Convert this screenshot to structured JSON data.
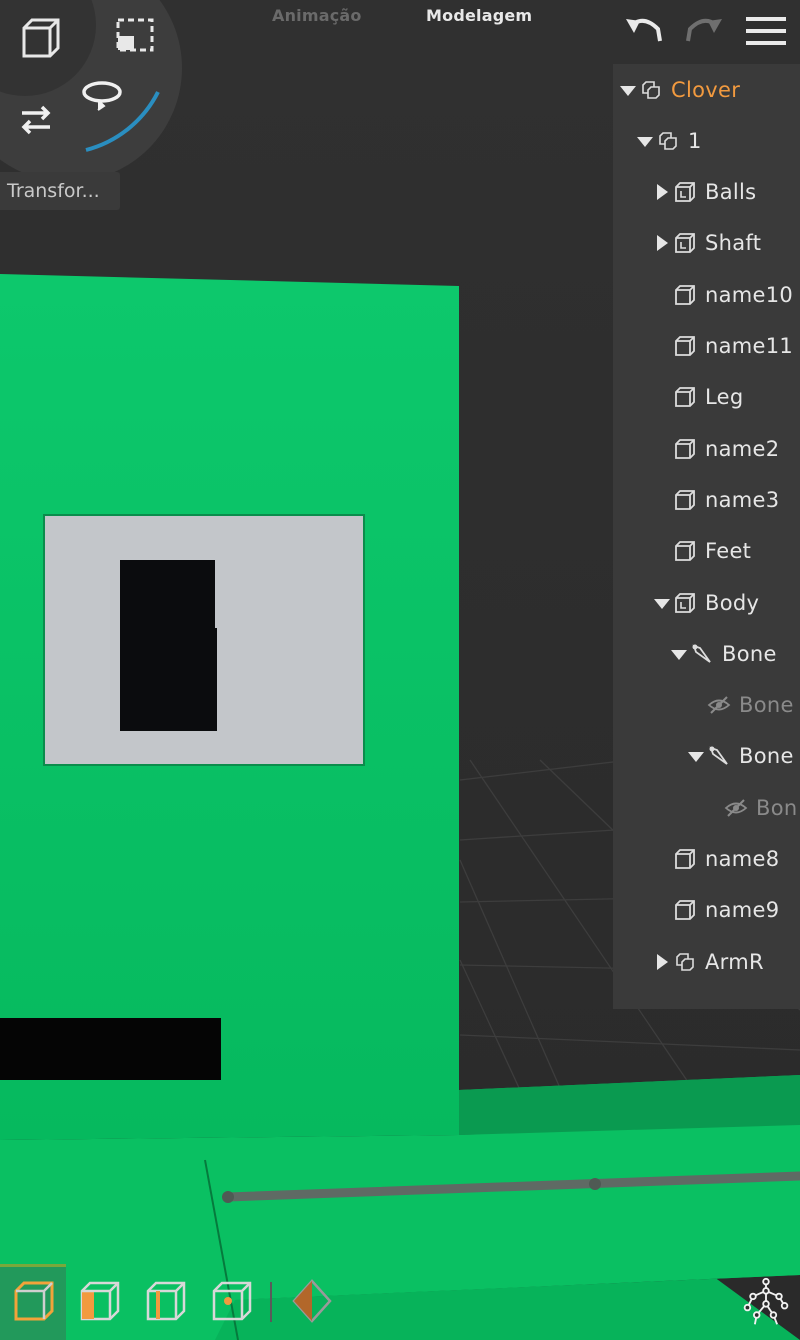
{
  "modes": {
    "animation_label": "Animação",
    "modeling_label": "Modelagem",
    "active": "Modelagem"
  },
  "gizmo": {
    "cube_icon": "cube-view-icon",
    "select_icon": "marquee-select-icon",
    "move_icon": "swap-arrows-icon",
    "rotate_icon": "rotate-icon",
    "rotation_fraction": 0.18
  },
  "transform_label": "Transfor...",
  "toolbar": {
    "undo_icon": "undo-icon",
    "redo_icon": "redo-icon",
    "menu_icon": "hamburger-menu-icon"
  },
  "outliner": {
    "items": [
      {
        "label": "Clover",
        "depth": 0,
        "expander": "expanded",
        "icon": "group-icon",
        "state": "root"
      },
      {
        "label": "1",
        "depth": 1,
        "expander": "expanded",
        "icon": "group-icon",
        "state": "normal"
      },
      {
        "label": "Balls",
        "depth": 2,
        "expander": "collapsed",
        "icon": "mesh-rig-icon",
        "state": "normal"
      },
      {
        "label": "Shaft",
        "depth": 2,
        "expander": "collapsed",
        "icon": "mesh-rig-icon",
        "state": "normal"
      },
      {
        "label": "name10",
        "depth": 2,
        "expander": "none",
        "icon": "cube-icon",
        "state": "normal"
      },
      {
        "label": "name11",
        "depth": 2,
        "expander": "none",
        "icon": "cube-icon",
        "state": "normal"
      },
      {
        "label": "Leg",
        "depth": 2,
        "expander": "none",
        "icon": "cube-icon",
        "state": "normal"
      },
      {
        "label": "name2",
        "depth": 2,
        "expander": "none",
        "icon": "cube-icon",
        "state": "normal"
      },
      {
        "label": "name3",
        "depth": 2,
        "expander": "none",
        "icon": "cube-icon",
        "state": "normal"
      },
      {
        "label": "Feet",
        "depth": 2,
        "expander": "none",
        "icon": "cube-icon",
        "state": "normal"
      },
      {
        "label": "Body",
        "depth": 2,
        "expander": "expanded",
        "icon": "mesh-rig-icon",
        "state": "normal"
      },
      {
        "label": "Bone",
        "depth": 3,
        "expander": "expanded",
        "icon": "bone-icon",
        "state": "normal"
      },
      {
        "label": "Bone",
        "depth": 4,
        "expander": "none",
        "icon": "hidden-eye-icon",
        "state": "hidden"
      },
      {
        "label": "Bone",
        "depth": 4,
        "expander": "expanded",
        "icon": "bone-icon",
        "state": "normal"
      },
      {
        "label": "Bon",
        "depth": 5,
        "expander": "none",
        "icon": "hidden-eye-icon",
        "state": "hidden"
      },
      {
        "label": "name8",
        "depth": 2,
        "expander": "none",
        "icon": "cube-icon",
        "state": "normal"
      },
      {
        "label": "name9",
        "depth": 2,
        "expander": "none",
        "icon": "cube-icon",
        "state": "normal"
      },
      {
        "label": "ArmR",
        "depth": 2,
        "expander": "collapsed",
        "icon": "group-icon",
        "state": "normal"
      }
    ]
  },
  "bottom_toolbar": {
    "buttons": [
      {
        "icon": "object-mode-icon",
        "active": true
      },
      {
        "icon": "face-mode-icon",
        "active": false
      },
      {
        "icon": "edge-mode-icon",
        "active": false
      },
      {
        "icon": "vertex-mode-icon",
        "active": false
      },
      {
        "icon": "pivot-mode-icon",
        "active": false
      }
    ],
    "rig_icon": "skeleton-rig-icon"
  },
  "colors": {
    "accent_orange": "#f29a3f",
    "model_green": "#0fbf66",
    "outliner_bg": "#3a3a3a",
    "viewport_bg": "#2c2c2c"
  }
}
